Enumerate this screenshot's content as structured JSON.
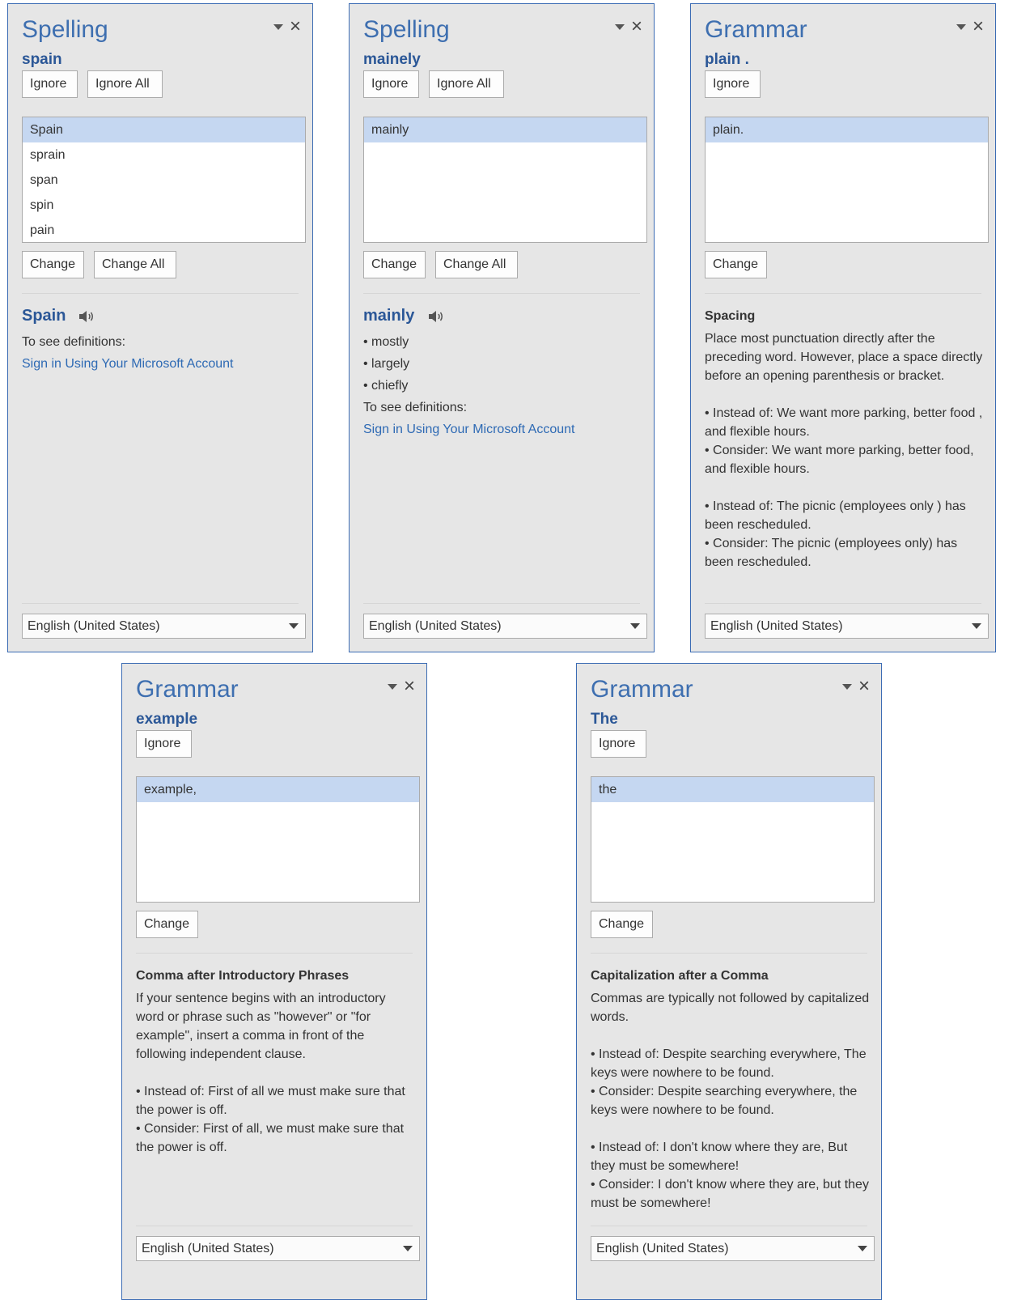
{
  "panes": [
    {
      "title": "Spelling",
      "word": "spain",
      "buttons": {
        "ignore": "Ignore",
        "ignore_all": "Ignore All",
        "change": "Change",
        "change_all": "Change All"
      },
      "suggestions": [
        "Spain",
        "sprain",
        "span",
        "spin",
        "pain"
      ],
      "definition": {
        "word": "Spain",
        "lines": [
          "To see definitions:"
        ],
        "link": "Sign in Using Your Microsoft Account"
      },
      "language": "English (United States)"
    },
    {
      "title": "Spelling",
      "word": "mainely",
      "buttons": {
        "ignore": "Ignore",
        "ignore_all": "Ignore All",
        "change": "Change",
        "change_all": "Change All"
      },
      "suggestions": [
        "mainly"
      ],
      "definition": {
        "word": "mainly",
        "lines": [
          "• mostly",
          "• largely",
          "• chiefly",
          "To see definitions:"
        ],
        "link": "Sign in Using Your Microsoft Account"
      },
      "language": "English (United States)"
    },
    {
      "title": "Grammar",
      "word": "plain .",
      "buttons": {
        "ignore": "Ignore",
        "change": "Change"
      },
      "suggestions": [
        "plain."
      ],
      "rule": {
        "title": "Spacing",
        "paragraphs": [
          "Place most punctuation directly after the preceding word. However, place a space directly before an opening parenthesis or bracket.",
          "",
          "• Instead of: We want more parking, better food , and flexible hours.",
          "• Consider: We want more parking, better food, and flexible hours.",
          "",
          "• Instead of: The picnic (employees only ) has been rescheduled.",
          "• Consider: The picnic (employees only) has been rescheduled."
        ]
      },
      "language": "English (United States)"
    },
    {
      "title": "Grammar",
      "word": "example",
      "buttons": {
        "ignore": "Ignore",
        "change": "Change"
      },
      "suggestions": [
        "example,"
      ],
      "rule": {
        "title": "Comma after Introductory Phrases",
        "paragraphs": [
          "If your sentence begins with an introductory word or phrase such as \"however\" or \"for example\", insert a comma in front of the following independent clause.",
          "",
          "• Instead of: First of all we must make sure that the power is off.",
          "• Consider: First of all, we must make sure that the power is off."
        ]
      },
      "language": "English (United States)"
    },
    {
      "title": "Grammar",
      "word": "The",
      "buttons": {
        "ignore": "Ignore",
        "change": "Change"
      },
      "suggestions": [
        "the"
      ],
      "rule": {
        "title": "Capitalization after a Comma",
        "paragraphs": [
          "Commas are typically not followed by capitalized words.",
          "",
          "• Instead of: Despite searching everywhere, The keys were nowhere to be found.",
          "• Consider: Despite searching everywhere, the keys were nowhere to be found.",
          "",
          "• Instead of: I don't know where they are, But they must be somewhere!",
          "• Consider: I don't know where they are, but they must be somewhere!"
        ]
      },
      "language": "English (United States)"
    }
  ],
  "icons": {
    "speaker": "speaker-icon",
    "menu": "chevron-down-icon",
    "close": "close-icon",
    "dropdown": "dropdown-arrow-icon"
  }
}
